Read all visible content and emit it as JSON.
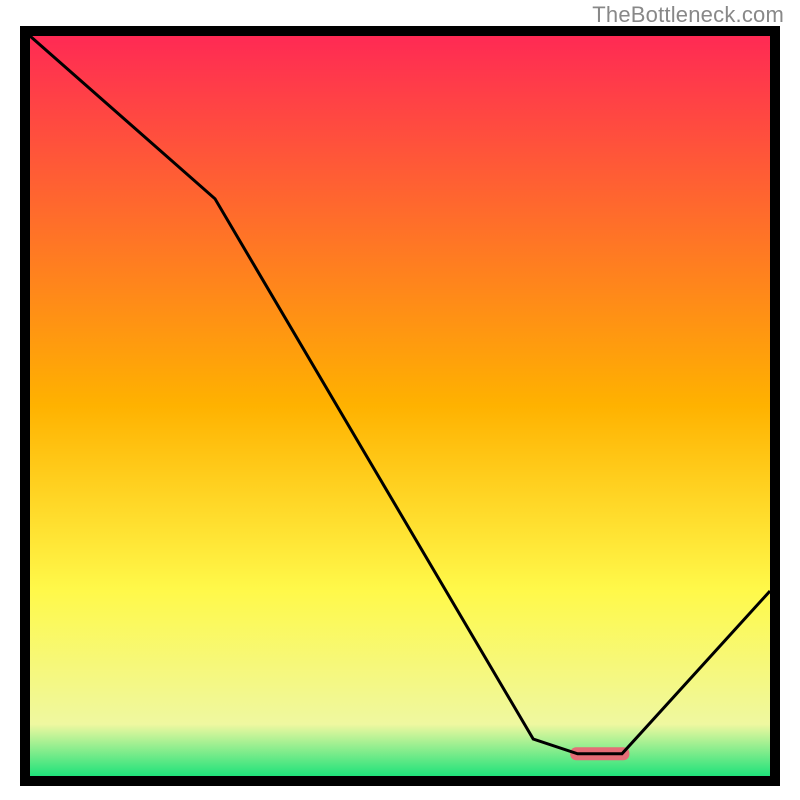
{
  "watermark": "TheBottleneck.com",
  "chart_data": {
    "type": "line",
    "title": "",
    "xlabel": "",
    "ylabel": "",
    "xlim": [
      0,
      100
    ],
    "ylim": [
      0,
      100
    ],
    "grid": false,
    "legend": false,
    "x": [
      0,
      25,
      68,
      74,
      80,
      100
    ],
    "values": [
      100,
      78,
      5,
      3,
      3,
      25
    ],
    "marker": {
      "x_range": [
        73,
        81
      ],
      "y": 3,
      "color": "#e46d76"
    },
    "gradient_stops": [
      {
        "offset": 0.0,
        "color": "#ff2a54"
      },
      {
        "offset": 0.5,
        "color": "#ffb200"
      },
      {
        "offset": 0.75,
        "color": "#fff94a"
      },
      {
        "offset": 0.93,
        "color": "#eff8a0"
      },
      {
        "offset": 1.0,
        "color": "#1fe27a"
      }
    ],
    "line_color": "#000000",
    "line_width": 3
  }
}
